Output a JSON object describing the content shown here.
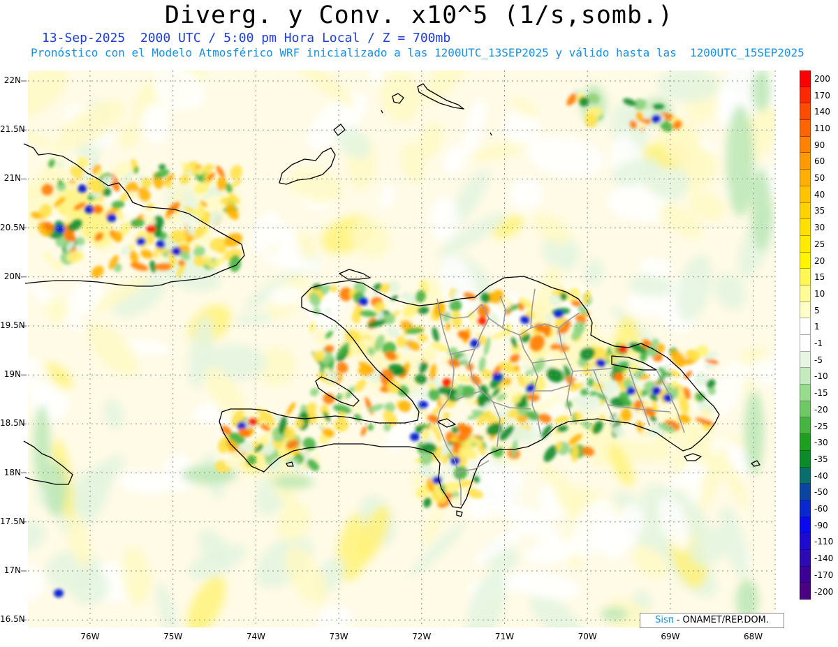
{
  "header": {
    "title": "Diverg. y Conv. x10^5 (1/s,somb.)",
    "subtitle1": "13-Sep-2025  2000 UTC / 5:00 pm Hora Local / Z = 700mb",
    "subtitle2": "Pronóstico con el Modelo Atmosférico WRF inicializado a las 1200UTC_13SEP2025 y válido hasta las  1200UTC_15SEP2025"
  },
  "axes": {
    "lat_labels": [
      "22N",
      "21.5N",
      "21N",
      "20.5N",
      "20N",
      "19.5N",
      "19N",
      "18.5N",
      "18N",
      "17.5N",
      "17N",
      "16.5N"
    ],
    "lon_labels": [
      "76W",
      "75W",
      "74W",
      "73W",
      "72W",
      "71W",
      "70W",
      "69W",
      "68W"
    ],
    "lat_range": [
      16.45,
      22.15
    ],
    "lon_range": [
      76.8,
      67.6
    ],
    "grid_style": "dotted"
  },
  "legend": {
    "labels": [
      "200",
      "170",
      "140",
      "110",
      "90",
      "60",
      "50",
      "40",
      "35",
      "30",
      "25",
      "20",
      "15",
      "10",
      "5",
      "1",
      "-1",
      "-5",
      "-10",
      "-15",
      "-20",
      "-25",
      "-30",
      "-35",
      "-40",
      "-50",
      "-60",
      "-90",
      "-110",
      "-140",
      "-170",
      "-200"
    ],
    "colors": [
      "#ff0000",
      "#ff2800",
      "#ff4b00",
      "#ff6400",
      "#ff8200",
      "#ff9b00",
      "#ffaf00",
      "#ffc300",
      "#ffd200",
      "#ffe100",
      "#ffeb00",
      "#fff500",
      "#fff852",
      "#fffb96",
      "#fffdc8",
      "#ffffff",
      "#ffffff",
      "#e6f5e1",
      "#c3ebbe",
      "#96dc8c",
      "#6ec864",
      "#46b441",
      "#1ea01e",
      "#0a8c28",
      "#0a6e6e",
      "#0a46a0",
      "#0a28d2",
      "#0a0af0",
      "#1e0ad2",
      "#2d0ab4",
      "#3c0096",
      "#4b0082"
    ]
  },
  "credit": {
    "sis": "Sisπ",
    "rest": " - ONAMET/REP.DOM."
  }
}
